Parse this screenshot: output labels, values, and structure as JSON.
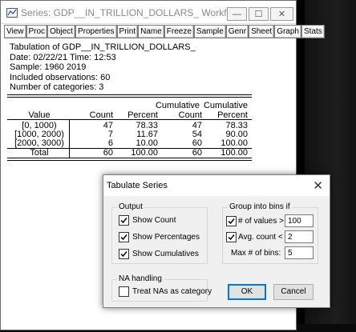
{
  "window": {
    "title": "Series: GDP__IN_TRILLION_DOLLARS_   Workfile:...",
    "minimize": "—",
    "maximize": "☐",
    "close": "✕"
  },
  "toolbar": {
    "buttons": [
      "View",
      "Proc",
      "Object",
      "Properties",
      "Print",
      "Name",
      "Freeze",
      "Sample",
      "Genr",
      "Sheet",
      "Graph",
      "Stats"
    ]
  },
  "output": {
    "header_lines": [
      "Tabulation of GDP__IN_TRILLION_DOLLARS_",
      "Date: 02/22/21   Time: 12:53",
      "Sample: 1960 2019",
      "Included observations: 60",
      "Number of categories: 3"
    ],
    "table": {
      "col_headers_top": [
        "",
        "",
        "",
        "Cumulative",
        "Cumulative"
      ],
      "col_headers": [
        "Value",
        "Count",
        "Percent",
        "Count",
        "Percent"
      ],
      "rows": [
        [
          "[0, 1000)",
          "47",
          "78.33",
          "47",
          "78.33"
        ],
        [
          "[1000, 2000)",
          "7",
          "11.67",
          "54",
          "90.00"
        ],
        [
          "[2000, 3000)",
          "6",
          "10.00",
          "60",
          "100.00"
        ]
      ],
      "total": [
        "Total",
        "60",
        "100.00",
        "60",
        "100.00"
      ]
    }
  },
  "dialog": {
    "title": "Tabulate Series",
    "output_group": {
      "label": "Output",
      "show_count": {
        "label": "Show Count",
        "checked": true
      },
      "show_percentages": {
        "label": "Show Percentages",
        "checked": true
      },
      "show_cumulatives": {
        "label": "Show Cumulatives",
        "checked": true
      }
    },
    "na_group": {
      "label": "NA handling",
      "treat_nas": {
        "label": "Treat NAs as category",
        "checked": false
      }
    },
    "bins_group": {
      "label": "Group into bins if",
      "num_values": {
        "label": "# of values >",
        "checked": true,
        "value": "100"
      },
      "avg_count": {
        "label": "Avg. count <",
        "checked": true,
        "value": "2"
      },
      "max_bins": {
        "label": "Max # of bins:",
        "value": "5"
      }
    },
    "ok_label": "OK",
    "cancel_label": "Cancel"
  }
}
